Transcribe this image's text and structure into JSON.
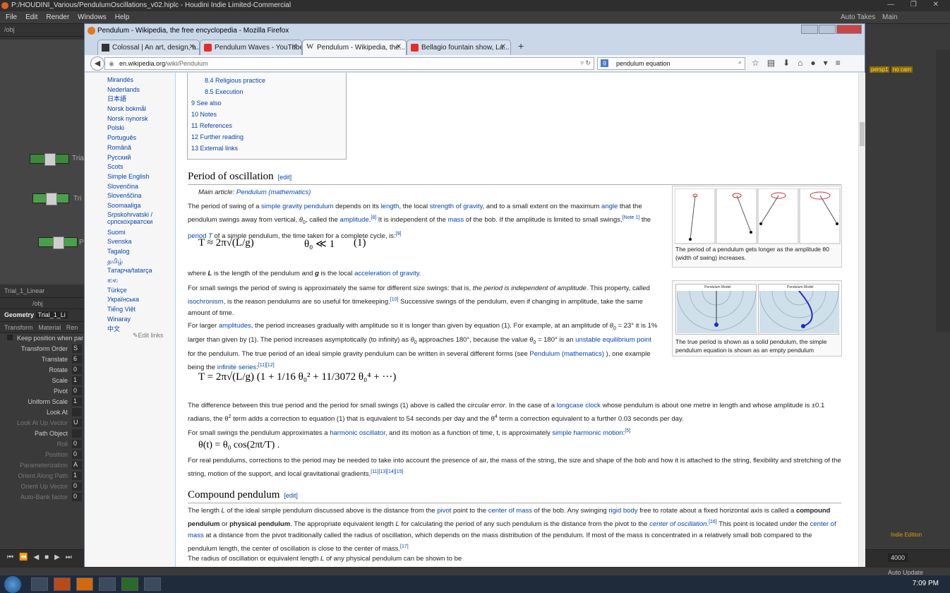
{
  "houdini": {
    "title": "P:/HOUDINI_Various/PendulumOscillations_v02.hiplc - Houdini Indie Limited-Commercial",
    "menu": [
      "File",
      "Edit",
      "Render",
      "Windows",
      "Help"
    ],
    "auto_takes": "Auto Takes",
    "main": "Main",
    "net_path": "/obj",
    "nodes": [
      "Tria",
      "Tri",
      "P"
    ],
    "node_name": "Trial_1_Linear",
    "geom_label": "Geometry",
    "geom_name": "Trial_1_Li",
    "param_tabs": [
      "Transform",
      "Material",
      "Ren"
    ],
    "keep_pos": "Keep position when par",
    "params": [
      {
        "label": "Transform Order",
        "val": "S",
        "dim": false
      },
      {
        "label": "Translate",
        "val": "6",
        "dim": false
      },
      {
        "label": "Rotate",
        "val": "0",
        "dim": false
      },
      {
        "label": "Scale",
        "val": "1",
        "dim": false
      },
      {
        "label": "Pivot",
        "val": "0",
        "dim": false
      },
      {
        "label": "Uniform Scale",
        "val": "1",
        "dim": false
      },
      {
        "label": "Look At",
        "val": "",
        "dim": false
      },
      {
        "label": "Look At Up Vector",
        "val": "U",
        "dim": true
      },
      {
        "label": "Path Object",
        "val": "",
        "dim": false
      },
      {
        "label": "Roll",
        "val": "0",
        "dim": true
      },
      {
        "label": "Position",
        "val": "0",
        "dim": true
      },
      {
        "label": "Parameterization",
        "val": "A",
        "dim": true
      },
      {
        "label": "Orient Along Path",
        "val": "1",
        "dim": true
      },
      {
        "label": "Orient Up Vector",
        "val": "0",
        "dim": true
      },
      {
        "label": "Auto-Bank factor",
        "val": "0",
        "dim": true
      }
    ],
    "viewport_labels": [
      "persp1",
      "no cam"
    ],
    "indie_edition": "Indie Edition",
    "frame": "4000",
    "auto_update": "Auto Update"
  },
  "taskbar": {
    "clock": "7:09 PM"
  },
  "firefox": {
    "window_title": "Pendulum - Wikipedia, the free encyclopedia - Mozilla Firefox",
    "tabs": [
      {
        "label": "Colossal | An art, design, a...",
        "icon_color": "#333"
      },
      {
        "label": "Pendulum Waves - YouTube",
        "icon_color": "#e52d27"
      },
      {
        "label": "Pendulum - Wikipedia, the...",
        "icon_color": "#222"
      },
      {
        "label": "Bellagio fountain show, La...",
        "icon_color": "#e52d27"
      }
    ],
    "url_domain": "en.wikipedia.org",
    "url_path": "/wiki/Pendulum",
    "search_text": "pendulum equation"
  },
  "wiki": {
    "languages": [
      "Mirandés",
      "Nederlands",
      "日本語",
      "Norsk bokmål",
      "Norsk nynorsk",
      "Polski",
      "Português",
      "Română",
      "Русский",
      "Scots",
      "Simple English",
      "Slovenčina",
      "Slovenščina",
      "Soomaaliga",
      "Srpskohrvatski / српскохрватски",
      "Suomi",
      "Svenska",
      "Tagalog",
      "தமிழ்",
      "Татарча/tatarça",
      "ತುಳು",
      "Türkçe",
      "Українська",
      "Tiếng Việt",
      "Winaray",
      "中文"
    ],
    "edit_links": "Edit links",
    "toc": [
      "8.4 Religious practice",
      "8.5 Execution",
      "9 See also",
      "10 Notes",
      "11 References",
      "12 Further reading",
      "13 External links"
    ],
    "section1": {
      "title": "Period of oscillation",
      "edit": "[edit]"
    },
    "main_article_prefix": "Main article: ",
    "main_article_link": "Pendulum (mathematics)",
    "section2": {
      "title": "Compound pendulum",
      "edit": "[edit]"
    },
    "fig1_caption": "The period of a pendulum gets longer as the amplitude θ0 (width of swing) increases.",
    "fig2_caption": "The true period is shown as a solid pendulum, the simple pendulum equation is shown as an empty pendulum",
    "fig2_panel": "Pendulum Model",
    "eq1": "T ≈ 2π√(L/g)",
    "eq1_cond": "θ₀ ≪ 1",
    "eq1_num": "(1)",
    "eq2": "T = 2π√(L/g) (1 + 1/16 θ₀² + 11/3072 θ₀⁴ + ···)",
    "eq3": "θ(t) = θ₀ cos(2πt/T) ."
  }
}
